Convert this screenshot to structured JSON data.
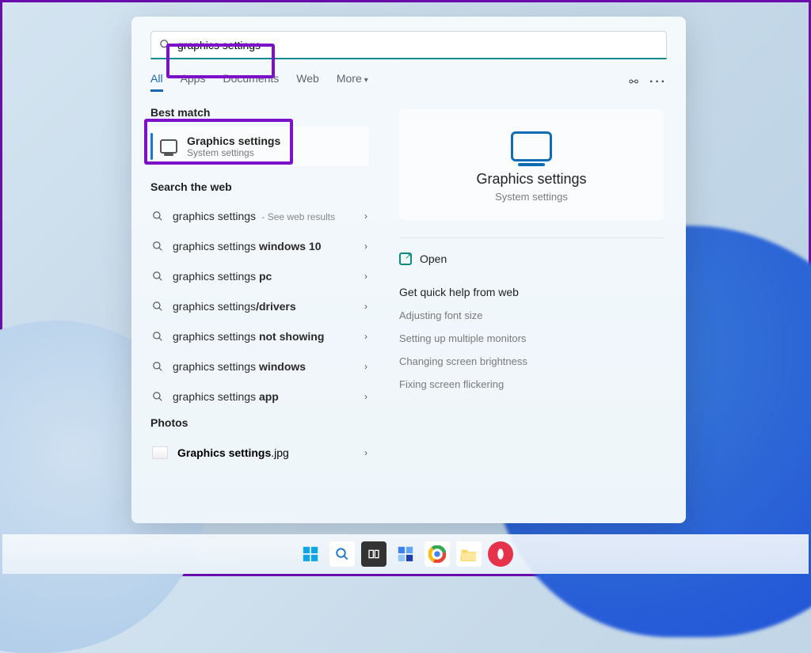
{
  "search": {
    "query": "graphics settings"
  },
  "tabs": {
    "all": "All",
    "apps": "Apps",
    "documents": "Documents",
    "web": "Web",
    "more": "More"
  },
  "sections": {
    "best_match": "Best match",
    "search_web": "Search the web",
    "photos": "Photos"
  },
  "best_match_item": {
    "title": "Graphics settings",
    "subtitle": "System settings"
  },
  "web_results": [
    {
      "prefix": "graphics settings",
      "bold": "",
      "suffix": "",
      "extra": " - See web results"
    },
    {
      "prefix": "graphics settings ",
      "bold": "windows 10",
      "suffix": "",
      "extra": ""
    },
    {
      "prefix": "graphics settings ",
      "bold": "pc",
      "suffix": "",
      "extra": ""
    },
    {
      "prefix": "graphics settings",
      "bold": "/drivers",
      "suffix": "",
      "extra": ""
    },
    {
      "prefix": "graphics settings ",
      "bold": "not showing",
      "suffix": "",
      "extra": ""
    },
    {
      "prefix": "graphics settings ",
      "bold": "windows",
      "suffix": "",
      "extra": ""
    },
    {
      "prefix": "graphics settings ",
      "bold": "app",
      "suffix": "",
      "extra": ""
    }
  ],
  "photos_item": {
    "name": "Graphics settings",
    "ext": ".jpg"
  },
  "preview": {
    "title": "Graphics settings",
    "subtitle": "System settings",
    "open": "Open",
    "help_label": "Get quick help from web",
    "help_links": [
      "Adjusting font size",
      "Setting up multiple monitors",
      "Changing screen brightness",
      "Fixing screen flickering"
    ]
  }
}
